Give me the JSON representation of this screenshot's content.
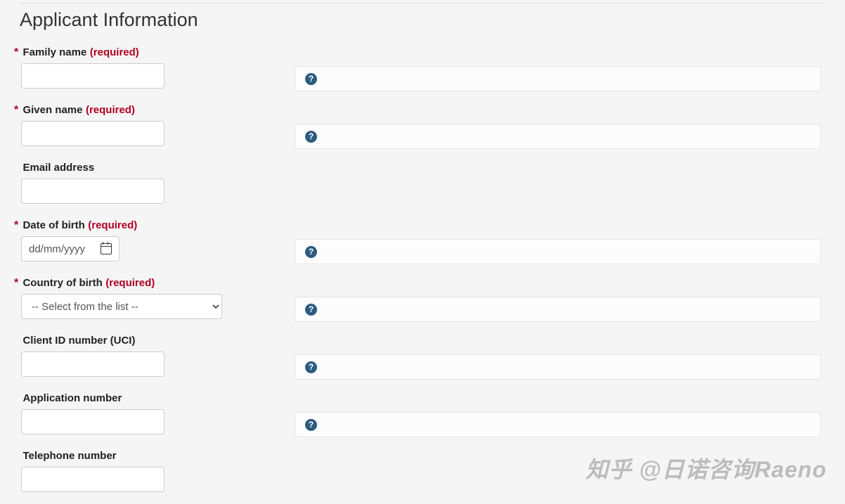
{
  "section_title": "Applicant Information",
  "required_marker": "*",
  "required_label": "(required)",
  "help_glyph": "?",
  "fields": {
    "family_name": {
      "label": "Family name",
      "required": true,
      "value": "",
      "help": true
    },
    "given_name": {
      "label": "Given name",
      "required": true,
      "value": "",
      "help": true
    },
    "email": {
      "label": "Email address",
      "required": false,
      "value": "",
      "help": false
    },
    "dob": {
      "label": "Date of birth",
      "required": true,
      "value": "",
      "placeholder": "dd/mm/yyyy",
      "help": true
    },
    "country": {
      "label": "Country of birth",
      "required": true,
      "selected": "-- Select from the list --",
      "help": true
    },
    "uci": {
      "label": "Client ID number (UCI)",
      "required": false,
      "value": "",
      "help": true
    },
    "app_no": {
      "label": "Application number",
      "required": false,
      "value": "",
      "help": true
    },
    "telephone": {
      "label": "Telephone number",
      "required": false,
      "value": "",
      "help": false
    }
  },
  "watermark": "知乎 @日诺咨询Raeno"
}
